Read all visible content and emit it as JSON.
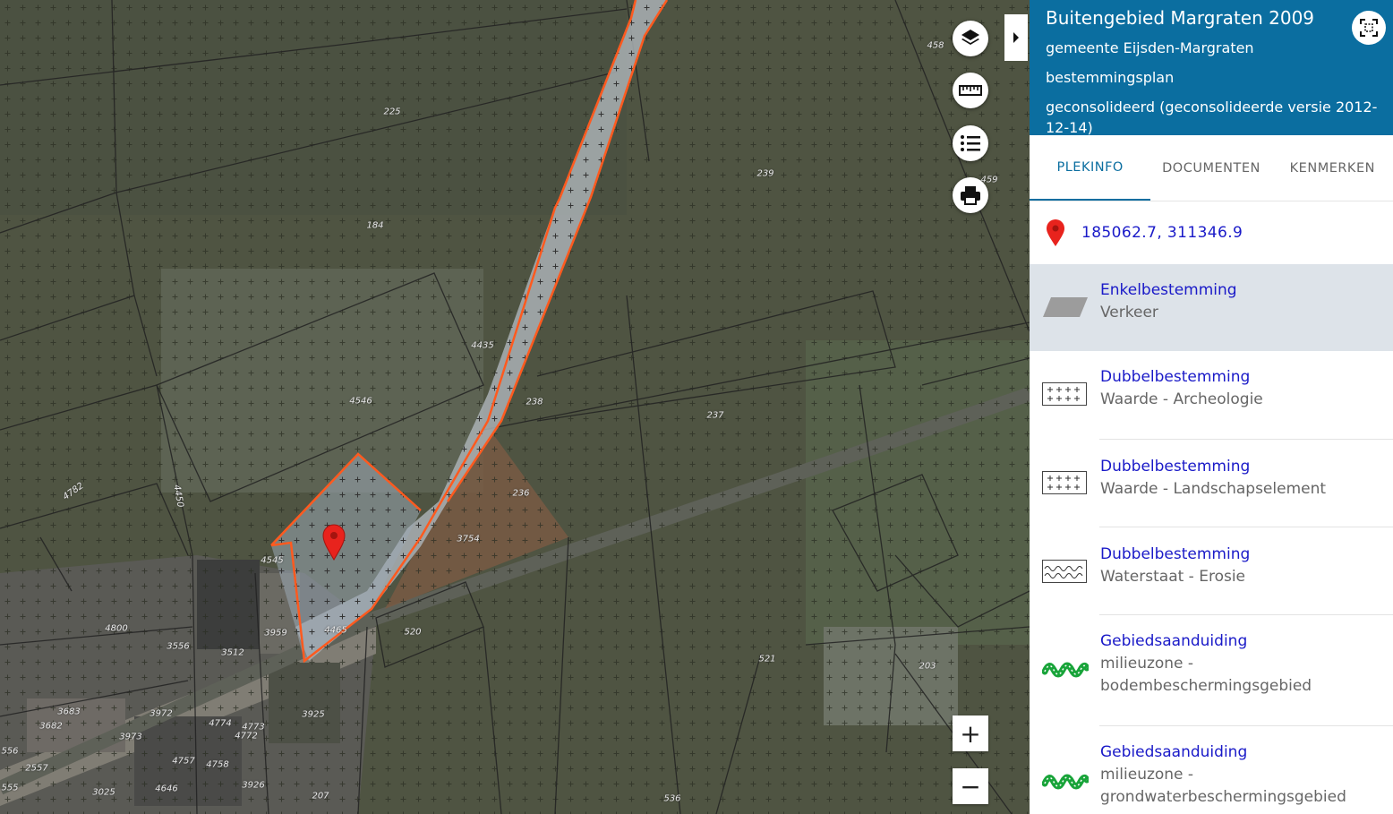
{
  "map": {
    "controls": {
      "layers_icon": "layers-icon",
      "measure_icon": "ruler-icon",
      "legend_icon": "list-icon",
      "print_icon": "printer-icon",
      "zoom_in": "+",
      "zoom_out": "−"
    },
    "parcel_labels": [
      "458",
      "225",
      "239",
      "459",
      "184",
      "4435",
      "4546",
      "238",
      "237",
      "4782",
      "4450",
      "236",
      "3754",
      "4545",
      "3959",
      "4465",
      "520",
      "4800",
      "3556",
      "3512",
      "521",
      "203",
      "3683",
      "3682",
      "3972",
      "3973",
      "4774",
      "4773",
      "4772",
      "3925",
      "4757",
      "4758",
      "3926",
      "4646",
      "3025",
      "2557",
      "556",
      "555",
      "207",
      "536"
    ],
    "colors": {
      "selection_outline": "#ff5a1f",
      "marker": "#e8231d"
    }
  },
  "panel": {
    "title": "Buitengebied Margraten 2009",
    "municipality": "gemeente Eijsden-Margraten",
    "type": "bestemmingsplan",
    "version": "geconsolideerd (geconsolideerde versie 2012-12-14)",
    "fullscreen_icon": "expand-icon",
    "tabs": [
      "PLEKINFO",
      "DOCUMENTEN",
      "KENMERKEN"
    ],
    "active_tab": "PLEKINFO",
    "coordinates": "185062.7, 311346.9",
    "items": [
      {
        "category": "Enkelbestemming",
        "name": "Verkeer",
        "icon": "parallelogram-icon"
      },
      {
        "category": "Dubbelbestemming",
        "name": "Waarde - Archeologie",
        "icon": "plus-grid-icon"
      },
      {
        "category": "Dubbelbestemming",
        "name": "Waarde - Landschapselement",
        "icon": "plus-grid-icon"
      },
      {
        "category": "Dubbelbestemming",
        "name": "Waterstaat - Erosie",
        "icon": "wave-pattern-icon"
      },
      {
        "category": "Gebiedsaanduiding",
        "name": "milieuzone - bodembeschermingsgebied",
        "icon": "green-zigzag-icon"
      },
      {
        "category": "Gebiedsaanduiding",
        "name": "milieuzone - grondwaterbeschermingsgebied",
        "icon": "green-zigzag-icon"
      }
    ],
    "colors": {
      "header_bg": "#0b6ea0",
      "link": "#1a1ac8",
      "selected_bg": "#dde3e9"
    }
  }
}
